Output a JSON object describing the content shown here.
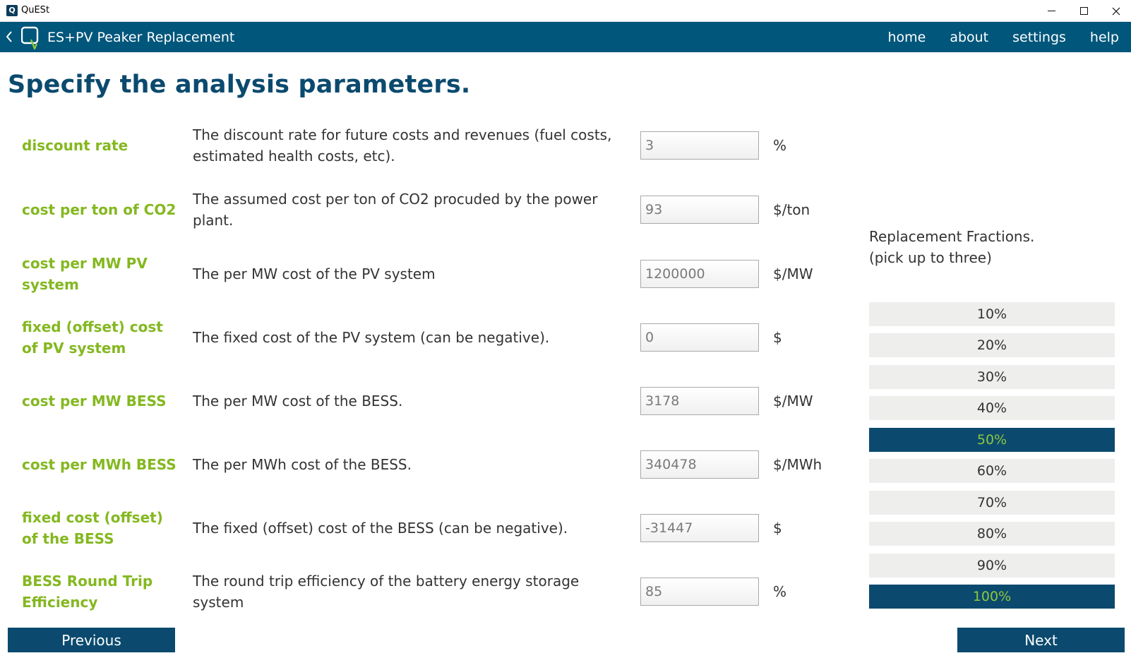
{
  "window": {
    "title": "QuESt"
  },
  "navbar": {
    "title": "ES+PV Peaker Replacement",
    "links": [
      "home",
      "about",
      "settings",
      "help"
    ]
  },
  "heading": "Specify the analysis parameters.",
  "params": [
    {
      "label": "discount rate",
      "description": "The discount rate for future costs and revenues (fuel costs, estimated health costs, etc).",
      "value": "3",
      "unit": "%"
    },
    {
      "label": "cost per ton of CO2",
      "description": "The assumed cost per ton of CO2 procuded by the power plant.",
      "value": "93",
      "unit": "$/ton"
    },
    {
      "label": "cost per MW PV system",
      "description": "The per MW cost of the PV system",
      "value": "1200000",
      "unit": "$/MW"
    },
    {
      "label": "fixed (offset) cost of PV system",
      "description": "The fixed cost of the PV system (can be negative).",
      "value": "0",
      "unit": "$"
    },
    {
      "label": "cost per MW BESS",
      "description": "The per MW cost of the BESS.",
      "value": "3178",
      "unit": "$/MW"
    },
    {
      "label": "cost per MWh BESS",
      "description": "The per MWh cost of the BESS.",
      "value": "340478",
      "unit": "$/MWh"
    },
    {
      "label": "fixed cost (offset) of the BESS",
      "description": "The fixed (offset) cost of the BESS (can be negative).",
      "value": "-31447",
      "unit": "$"
    },
    {
      "label": "BESS Round Trip Efficiency",
      "description": "The round trip efficiency of the battery energy storage system",
      "value": "85",
      "unit": "%"
    }
  ],
  "fractions": {
    "title_line1": "Replacement Fractions.",
    "title_line2": "(pick up to three)",
    "options": [
      {
        "label": "10%",
        "selected": false
      },
      {
        "label": "20%",
        "selected": false
      },
      {
        "label": "30%",
        "selected": false
      },
      {
        "label": "40%",
        "selected": false
      },
      {
        "label": "50%",
        "selected": true
      },
      {
        "label": "60%",
        "selected": false
      },
      {
        "label": "70%",
        "selected": false
      },
      {
        "label": "80%",
        "selected": false
      },
      {
        "label": "90%",
        "selected": false
      },
      {
        "label": "100%",
        "selected": true
      }
    ]
  },
  "buttons": {
    "previous": "Previous",
    "next": "Next"
  },
  "colors": {
    "navbar": "#00567b",
    "heading": "#0b4a6e",
    "label": "#84b820",
    "selected_bg": "#0b4a6e",
    "selected_text": "#8ec63f",
    "unselected_bg": "#eeeeec"
  }
}
